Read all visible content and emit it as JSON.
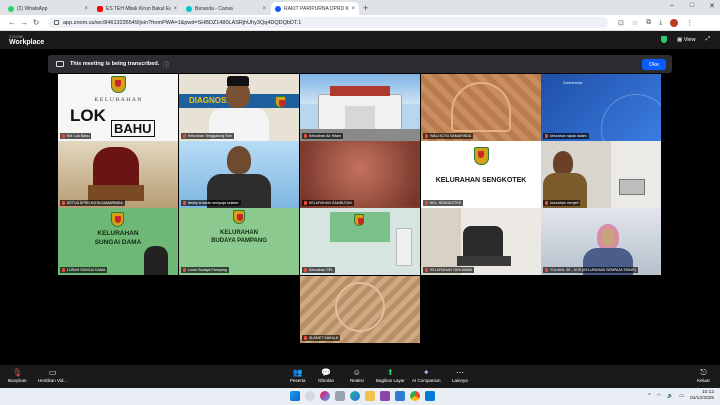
{
  "browser": {
    "tabs": [
      {
        "label": "(2) WhatsApp",
        "icon": "whatsapp-icon",
        "color": "#25D366",
        "active": false
      },
      {
        "label": "ES TEH Mbak Kirun Bakul Es Teh",
        "icon": "youtube-icon",
        "color": "#FF0000",
        "active": false
      },
      {
        "label": "Beranda - Canva",
        "icon": "canva-icon",
        "color": "#00C4CC",
        "active": false
      },
      {
        "label": "RAKIT PARIPURNA DPRD KOTA",
        "icon": "zoom-icon",
        "color": "#0B5CFF",
        "active": true
      }
    ],
    "new_tab": "+",
    "url": "app.zoom.us/wc/84613235549/join?fromPWA=1&pwd=SHBDZ1480LASRjhUhy3Qq4DQDQbDT.1"
  },
  "zoom": {
    "small_label": "ZOOM",
    "title": "Workplace",
    "view_label": "View",
    "transcribe_banner": "This meeting is being transcribed.",
    "ok_button": "Oke"
  },
  "participants": [
    {
      "name": "Kel. Lok Bahu"
    },
    {
      "name": "Kelurahan Tenggarong Seb"
    },
    {
      "name": "Kelurahan Air Hitam"
    },
    {
      "name": "WALI KOTA SAMARINDA"
    },
    {
      "name": "kelurahan rapak dalam"
    },
    {
      "name": "KETUA DPRD KOTA SAMARINDA"
    },
    {
      "name": "destry w karah sempaja selatan"
    },
    {
      "name": "KELURAHAN SAMBUTAN"
    },
    {
      "name": "KEL. SENGKOTEK"
    },
    {
      "name": "kelurahan menjeti"
    },
    {
      "name": "LURAH SUNGAI DAMA"
    },
    {
      "name": "Lurah Budaya Pampang"
    },
    {
      "name": "Kelurahan SPL"
    },
    {
      "name": "KELURAHAN TANI AMAN"
    },
    {
      "name": "YULIANI, SE., M.Si (KELURAHAN SEMPAJA TIMUR)"
    },
    {
      "name": "SLAMET SAKALE"
    }
  ],
  "tile_text": {
    "lokbahu_kel": "K E L U R A H A N",
    "lokbahu_lok": "LOK",
    "lokbahu_bahu": "BAHU",
    "sengkotek": "KELURAHAN SENGKOTEK",
    "sungaidama_1": "KELURAHAN",
    "sungaidama_2": "SUNGAI DAMA",
    "budaya_1": "KELURAHAN",
    "budaya_2": "BUDAYA PAMPANG",
    "banner_text": "DIAGNOSA",
    "brand_text": "Samarinda"
  },
  "toolbar": {
    "mute": "Bunyikan",
    "video": "Hentikan Vid...",
    "participants": "Peserta",
    "chat": "Obrolan",
    "react": "Reaksi",
    "share": "Bagikan Layar",
    "ai": "AI Companion",
    "more": "Lainnya",
    "leave": "Keluar"
  },
  "taskbar": {
    "time": "10:12",
    "date": "04/12/2025"
  }
}
